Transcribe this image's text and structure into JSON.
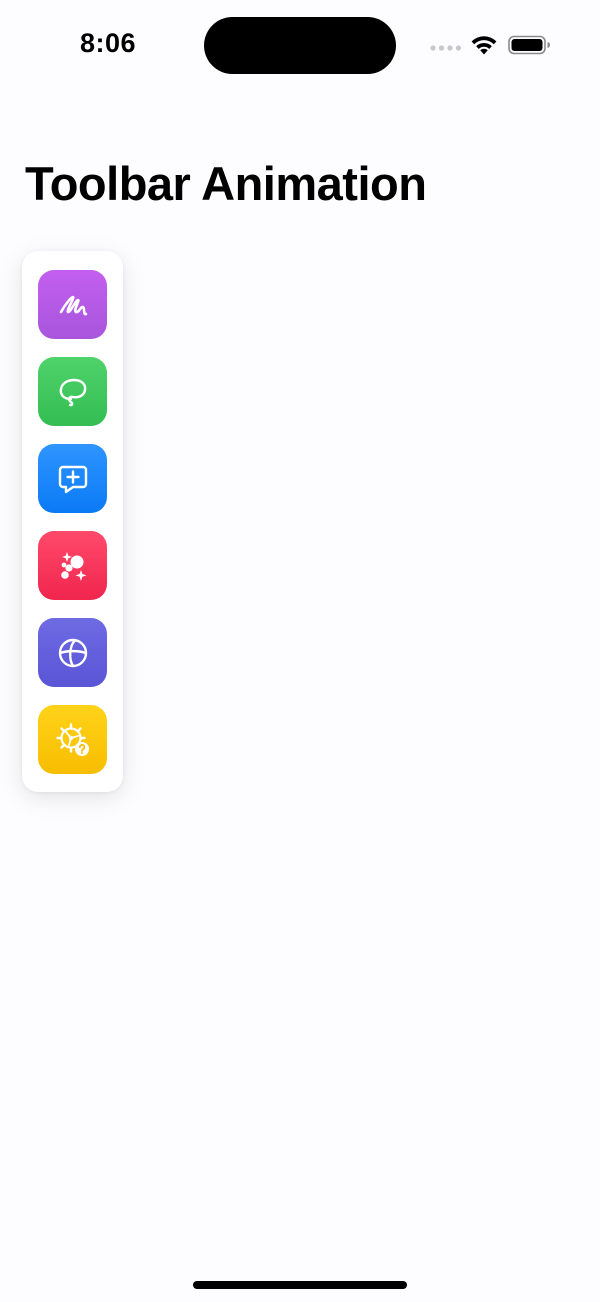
{
  "status_bar": {
    "time": "8:06"
  },
  "header": {
    "title": "Toolbar Animation"
  },
  "toolbar": {
    "items": [
      {
        "name": "scribble",
        "icon": "scribble-icon",
        "color_top": "#c35ff0",
        "color_bottom": "#a855dc"
      },
      {
        "name": "lasso",
        "icon": "lasso-icon",
        "color_top": "#4fd36a",
        "color_bottom": "#33bd52"
      },
      {
        "name": "add-comment",
        "icon": "message-plus-icon",
        "color_top": "#2f95ff",
        "color_bottom": "#0a7af5"
      },
      {
        "name": "sparkles",
        "icon": "sparkle-bubbles-icon",
        "color_top": "#ff4a6b",
        "color_bottom": "#f0254e"
      },
      {
        "name": "globe",
        "icon": "globe-icon",
        "color_top": "#6e6be3",
        "color_bottom": "#5a55d6"
      },
      {
        "name": "settings-help",
        "icon": "gear-question-icon",
        "color_top": "#ffd31a",
        "color_bottom": "#f7bd00"
      }
    ]
  }
}
